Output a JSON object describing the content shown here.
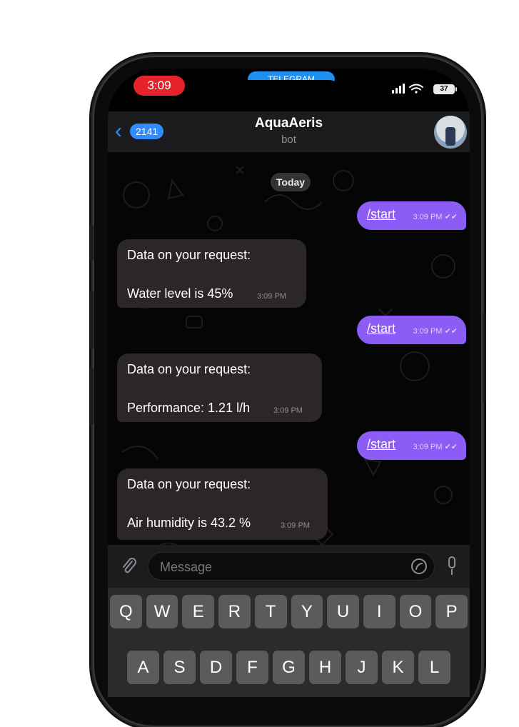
{
  "status_bar": {
    "time": "3:09",
    "live_activity": "TELEGRAM",
    "battery": "37"
  },
  "header": {
    "back_count": "2141",
    "title": "AquaAeris",
    "subtitle": "bot"
  },
  "date_separator": "Today",
  "messages": [
    {
      "direction": "out",
      "text": "/start",
      "time": "3:09 PM"
    },
    {
      "direction": "in",
      "line1": "Data on your request:",
      "line2": "Water level is 45%",
      "time": "3:09 PM"
    },
    {
      "direction": "out",
      "text": "/start",
      "time": "3:09 PM"
    },
    {
      "direction": "in",
      "line1": "Data on your request:",
      "line2": "Performance: 1.21 l/h",
      "time": "3:09 PM"
    },
    {
      "direction": "out",
      "text": "/start",
      "time": "3:09 PM"
    },
    {
      "direction": "in",
      "line1": "Data on your request:",
      "line2": "Air humidity is 43.2 %",
      "time": "3:09 PM"
    }
  ],
  "composer": {
    "placeholder": "Message"
  },
  "keyboard": {
    "row1": [
      "Q",
      "W",
      "E",
      "R",
      "T",
      "Y",
      "U",
      "I",
      "O",
      "P"
    ],
    "row2": [
      "A",
      "S",
      "D",
      "F",
      "G",
      "H",
      "J",
      "K",
      "L"
    ]
  },
  "colors": {
    "outgoing_bubble": "#8b5cf6",
    "incoming_bubble": "#2c282c",
    "accent": "#2f8cff",
    "time_pill": "#e5242a"
  },
  "icons": [
    "signal-icon",
    "wifi-icon",
    "battery-icon",
    "back-chevron-icon",
    "attach-icon",
    "sticker-icon",
    "mic-icon",
    "read-check-icon"
  ]
}
